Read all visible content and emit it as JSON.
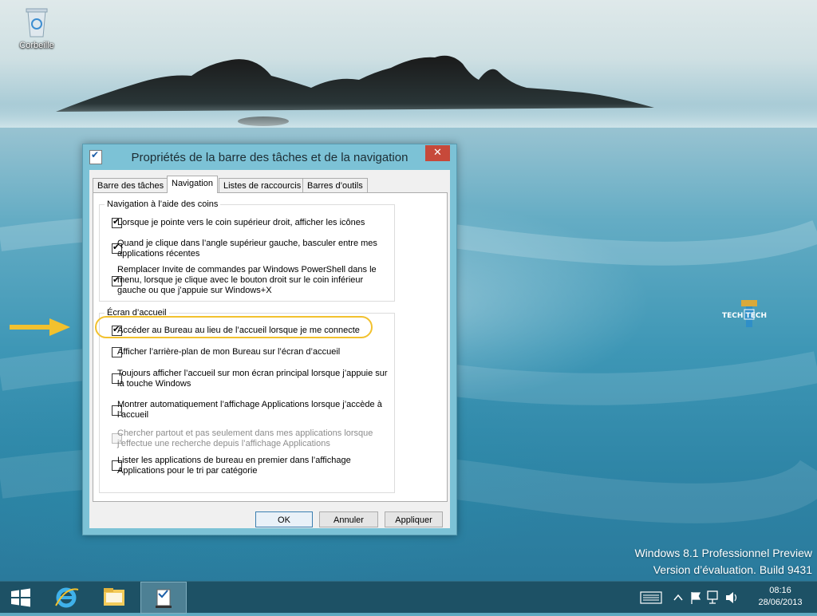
{
  "desktop": {
    "icons": [
      {
        "label": "Corbeille",
        "icon": "recycle-bin-icon"
      }
    ],
    "watermark": {
      "line1": "Windows 8.1 Professionnel Preview",
      "line2": "Version d’évaluation. Build 9431"
    },
    "logo_text": "TECH TECH"
  },
  "dialog": {
    "title": "Propriétés de la barre des tâches et de la navigation",
    "close_label": "✕",
    "tabs": [
      {
        "label": "Barre des tâches",
        "active": false
      },
      {
        "label": "Navigation",
        "active": true
      },
      {
        "label": "Listes de raccourcis",
        "active": false
      },
      {
        "label": "Barres d’outils",
        "active": false
      }
    ],
    "groups": {
      "corners": {
        "title": "Navigation à l’aide des coins",
        "options": [
          {
            "label": "Lorsque je pointe vers le coin supérieur droit, afficher les icônes",
            "checked": true
          },
          {
            "label": "Quand je clique dans l’angle supérieur gauche, basculer entre mes applications récentes",
            "checked": true
          },
          {
            "label": "Remplacer Invite de commandes par Windows PowerShell dans le menu, lorsque je clique avec le bouton droit sur le coin inférieur gauche ou que j’appuie sur Windows+X",
            "checked": true
          }
        ]
      },
      "start": {
        "title": "Écran d’accueil",
        "options": [
          {
            "label": "Accéder au Bureau au lieu de l’accueil lorsque je me connecte",
            "checked": true
          },
          {
            "label": "Afficher l’arrière-plan de mon Bureau sur l’écran d’accueil",
            "checked": false
          },
          {
            "label": "Toujours afficher l’accueil sur mon écran principal lorsque j’appuie sur la touche Windows",
            "checked": false
          },
          {
            "label": "Montrer automatiquement l’affichage Applications lorsque j’accède à l’accueil",
            "checked": false
          },
          {
            "label": "Chercher partout et pas seulement dans mes applications lorsque j’effectue une recherche depuis l’affichage Applications",
            "checked": false,
            "disabled": true
          },
          {
            "label": "Lister les applications de bureau en premier dans l’affichage Applications pour le tri par catégorie",
            "checked": false
          }
        ]
      }
    },
    "buttons": {
      "ok": "OK",
      "cancel": "Annuler",
      "apply": "Appliquer"
    }
  },
  "taskbar": {
    "items": [
      "start-icon",
      "internet-explorer-icon",
      "file-explorer-icon",
      "taskbar-properties-icon"
    ],
    "tray": {
      "time": "08:16",
      "date": "28/06/2013"
    }
  },
  "colors": {
    "highlight": "#f2c12e",
    "close_button": "#c7493a",
    "dialog_frame": "#7cc2d6",
    "taskbar": "#1d5165"
  }
}
